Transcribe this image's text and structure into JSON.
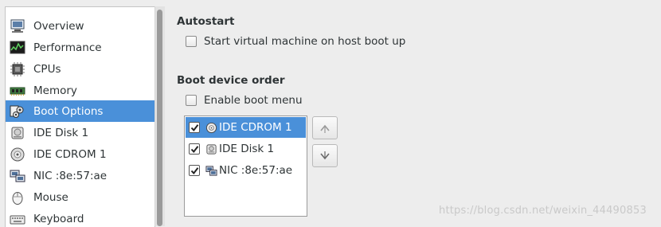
{
  "sidebar": {
    "items": [
      {
        "label": "Overview",
        "icon": "monitor-icon"
      },
      {
        "label": "Performance",
        "icon": "performance-graph-icon"
      },
      {
        "label": "CPUs",
        "icon": "cpu-chip-icon"
      },
      {
        "label": "Memory",
        "icon": "memory-module-icon"
      },
      {
        "label": "Boot Options",
        "icon": "boot-gears-icon",
        "selected": true
      },
      {
        "label": "IDE Disk 1",
        "icon": "hard-disk-icon"
      },
      {
        "label": "IDE CDROM 1",
        "icon": "cdrom-icon"
      },
      {
        "label": "NIC :8e:57:ae",
        "icon": "network-card-icon"
      },
      {
        "label": "Mouse",
        "icon": "mouse-icon"
      },
      {
        "label": "Keyboard",
        "icon": "keyboard-icon"
      }
    ]
  },
  "autostart": {
    "heading": "Autostart",
    "checkbox_label": "Start virtual machine on host boot up",
    "checked": false
  },
  "boot_order": {
    "heading": "Boot device order",
    "menu_checkbox_label": "Enable boot menu",
    "menu_checked": false,
    "devices": [
      {
        "label": "IDE CDROM 1",
        "checked": true,
        "selected": true,
        "icon": "cdrom-icon"
      },
      {
        "label": "IDE Disk 1",
        "checked": true,
        "selected": false,
        "icon": "hard-disk-icon"
      },
      {
        "label": "NIC :8e:57:ae",
        "checked": true,
        "selected": false,
        "icon": "network-card-icon"
      }
    ],
    "move_up_icon": "arrow-up-icon",
    "move_down_icon": "arrow-down-icon"
  },
  "watermark": "https://blog.csdn.net/weixin_44490853",
  "colors": {
    "selection": "#4a90d9",
    "background": "#ededed"
  }
}
